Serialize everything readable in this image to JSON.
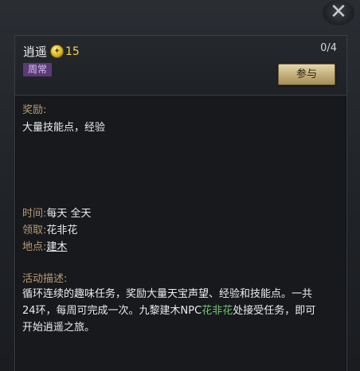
{
  "header": {
    "title": "逍遥",
    "coin_value": "15",
    "badge": "周常",
    "progress": "0/4",
    "join_label": "参与"
  },
  "reward": {
    "label": "奖励:",
    "text": "大量技能点，经验"
  },
  "info": {
    "time_label": "时间:",
    "time_value": "每天 全天",
    "receive_label": "领取:",
    "receive_value": "花非花",
    "place_label": "地点:",
    "place_value": "建木"
  },
  "description": {
    "label": "活动描述:",
    "part1": "循环连续的趣味任务，奖励大量天宝声望、经验和技能点。一共24环，每周可完成一次。九黎建木NPC",
    "npc": "花非花",
    "part2": "处接受任务，即可开始逍遥之旅。"
  },
  "icons": {
    "close": "close-icon",
    "coin": "coin-icon"
  },
  "colors": {
    "label": "#b89c74",
    "npc_highlight": "#6fc86f",
    "coin": "#f4d34a",
    "badge_bg": "#5b3a78"
  }
}
